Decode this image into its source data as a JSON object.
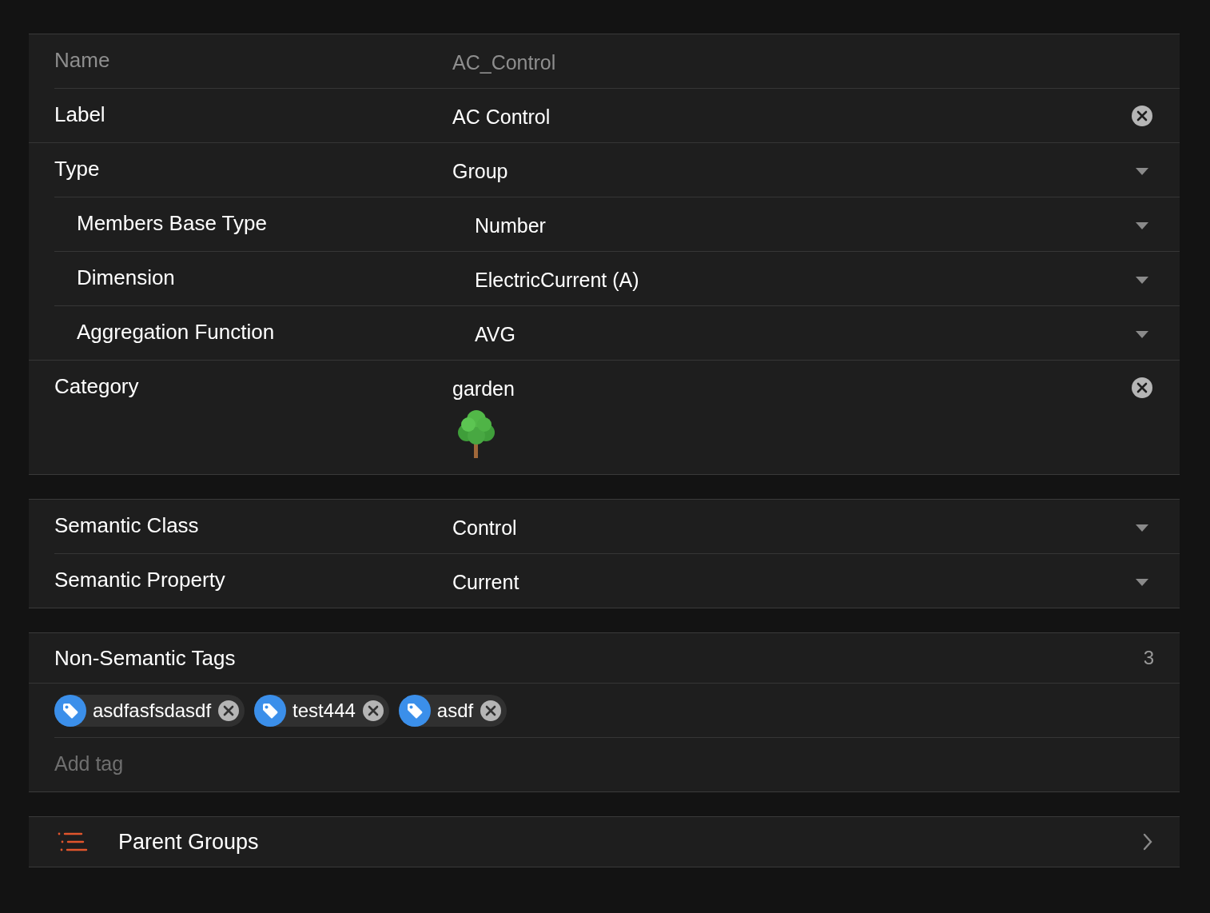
{
  "sections": [
    {
      "rows": [
        {
          "kind": "text",
          "label": "Name",
          "value": "AC_Control",
          "disabled": true
        },
        {
          "kind": "clearable",
          "label": "Label",
          "value": "AC Control",
          "disabled": false
        },
        {
          "kind": "dropdown",
          "label": "Type",
          "value": "Group",
          "disabled": false,
          "children": [
            {
              "kind": "dropdown",
              "label": "Members Base Type",
              "value": "Number",
              "disabled": false
            },
            {
              "kind": "dropdown",
              "label": "Dimension",
              "value": "ElectricCurrent (A)",
              "disabled": false
            },
            {
              "kind": "dropdown",
              "label": "Aggregation Function",
              "value": "AVG",
              "disabled": false
            }
          ]
        },
        {
          "kind": "category",
          "label": "Category",
          "value": "garden",
          "disabled": false
        }
      ]
    },
    {
      "rows": [
        {
          "kind": "dropdown",
          "label": "Semantic Class",
          "value": "Control",
          "disabled": false
        },
        {
          "kind": "dropdown",
          "label": "Semantic Property",
          "value": "Current",
          "disabled": false
        }
      ]
    }
  ],
  "tags": {
    "title": "Non-Semantic Tags",
    "count": "3",
    "items": [
      {
        "label": "asdfasfsdasdf"
      },
      {
        "label": "test444"
      },
      {
        "label": "asdf"
      }
    ],
    "placeholder": "Add tag"
  },
  "parent_groups": {
    "label": "Parent Groups"
  }
}
